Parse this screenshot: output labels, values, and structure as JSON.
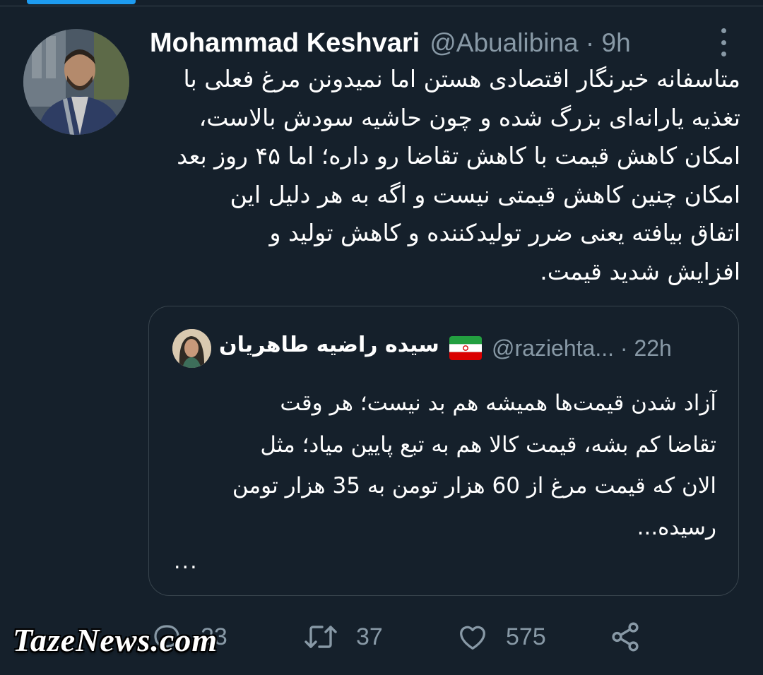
{
  "tweet": {
    "author_name": "Mohammad Keshvari",
    "author_handle": "@Abualibina",
    "time": "9h",
    "text": "متاسفانه خبرنگار اقتصادی هستن اما نمیدونن مرغ فعلی با\nتغذیه یارانه‌ای بزرگ شده و چون حاشیه سودش بالاست،\nامکان کاهش قیمت با کاهش تقاضا رو داره؛ اما ۴۵ روز بعد\nامکان چنین کاهش قیمتی نیست و اگه به هر دلیل این\nاتفاق بیافته یعنی ضرر تولیدکننده و کاهش تولید و\nافزایش شدید قیمت."
  },
  "quote": {
    "author_name": "سیده راضیه طاهریان",
    "author_handle": "@raziehta...",
    "time": "22h",
    "text": "آزاد شدن قیمت‌ها همیشه هم بد نیست؛ هر وقت\nتقاضا کم بشه، قیمت کالا هم به تبع پایین میاد؛ مثل\nالان که قیمت مرغ از 60 هزار تومن به 35 هزار تومن\nرسیده...",
    "ellipsis": "..."
  },
  "actions": {
    "replies": "23",
    "retweets": "37",
    "likes": "575"
  },
  "icons": {
    "reply": "reply-icon",
    "retweet": "retweet-icon",
    "like": "heart-icon",
    "share": "share-icon",
    "more": "more-options-icon"
  },
  "watermark": "TazeNews.com",
  "colors": {
    "background": "#15202b",
    "border": "#38444d",
    "secondary_text": "#8899a6",
    "accent": "#1d9bf0"
  }
}
